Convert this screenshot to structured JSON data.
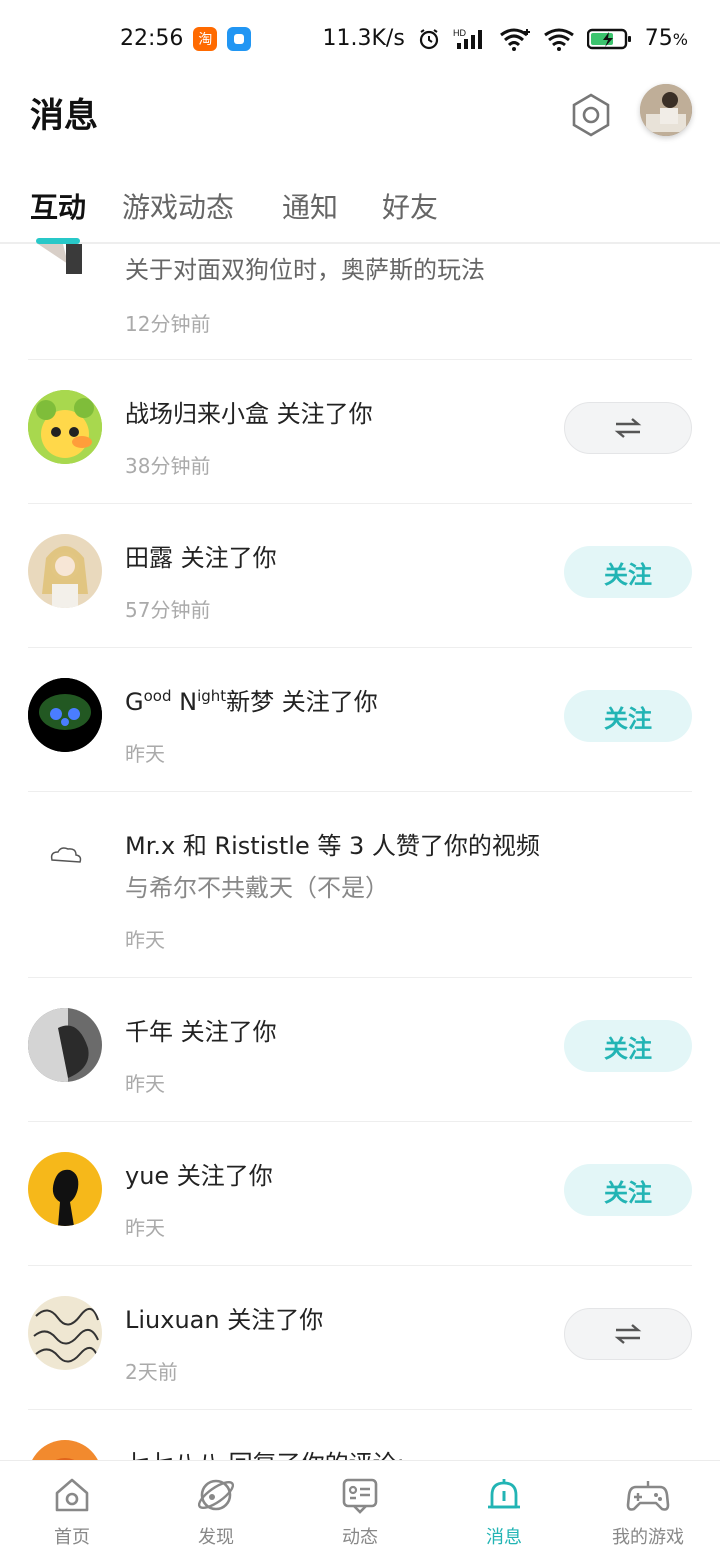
{
  "status_bar": {
    "time": "22:56",
    "network_speed": "11.3K/s",
    "battery": "75",
    "battery_unit": "%"
  },
  "header": {
    "title": "消息"
  },
  "tabs": [
    {
      "label": "互动",
      "active": true
    },
    {
      "label": "游戏动态",
      "active": false
    },
    {
      "label": "通知",
      "active": false
    },
    {
      "label": "好友",
      "active": false
    }
  ],
  "items": [
    {
      "text": "关于对面双狗位时，奥萨斯的玩法",
      "time": "12分钟前"
    },
    {
      "text": "战场归来小盒 关注了你",
      "time": "38分钟前",
      "action": "mutual"
    },
    {
      "text": "田露 关注了你",
      "time": "57分钟前",
      "action": "follow"
    },
    {
      "text_prefix_1": "G",
      "text_sup_1": "ood",
      "text_mid": " N",
      "text_sup_2": "ight",
      "text_suffix": "新梦 关注了你",
      "time": "昨天",
      "action": "follow"
    },
    {
      "text": "Mr.x 和 Rististle 等 3 人赞了你的视频",
      "subtext": "与希尔不共戴天（不是）",
      "time": "昨天"
    },
    {
      "text": "千年 关注了你",
      "time": "昨天",
      "action": "follow"
    },
    {
      "text": "yue 关注了你",
      "time": "昨天",
      "action": "follow"
    },
    {
      "text": "Liuxuan 关注了你",
      "time": "2天前",
      "action": "mutual"
    },
    {
      "text": "七七八八 回复了你的评论:"
    }
  ],
  "follow_label": "关注",
  "nav": [
    {
      "label": "首页",
      "icon": "home-icon"
    },
    {
      "label": "发现",
      "icon": "discover-icon"
    },
    {
      "label": "动态",
      "icon": "feed-icon"
    },
    {
      "label": "消息",
      "icon": "bell-icon",
      "active": true
    },
    {
      "label": "我的游戏",
      "icon": "gamepad-icon"
    }
  ],
  "colors": {
    "accent": "#22b4b4",
    "follow_bg": "#e3f6f7",
    "mutual_bg": "#f3f4f5"
  }
}
